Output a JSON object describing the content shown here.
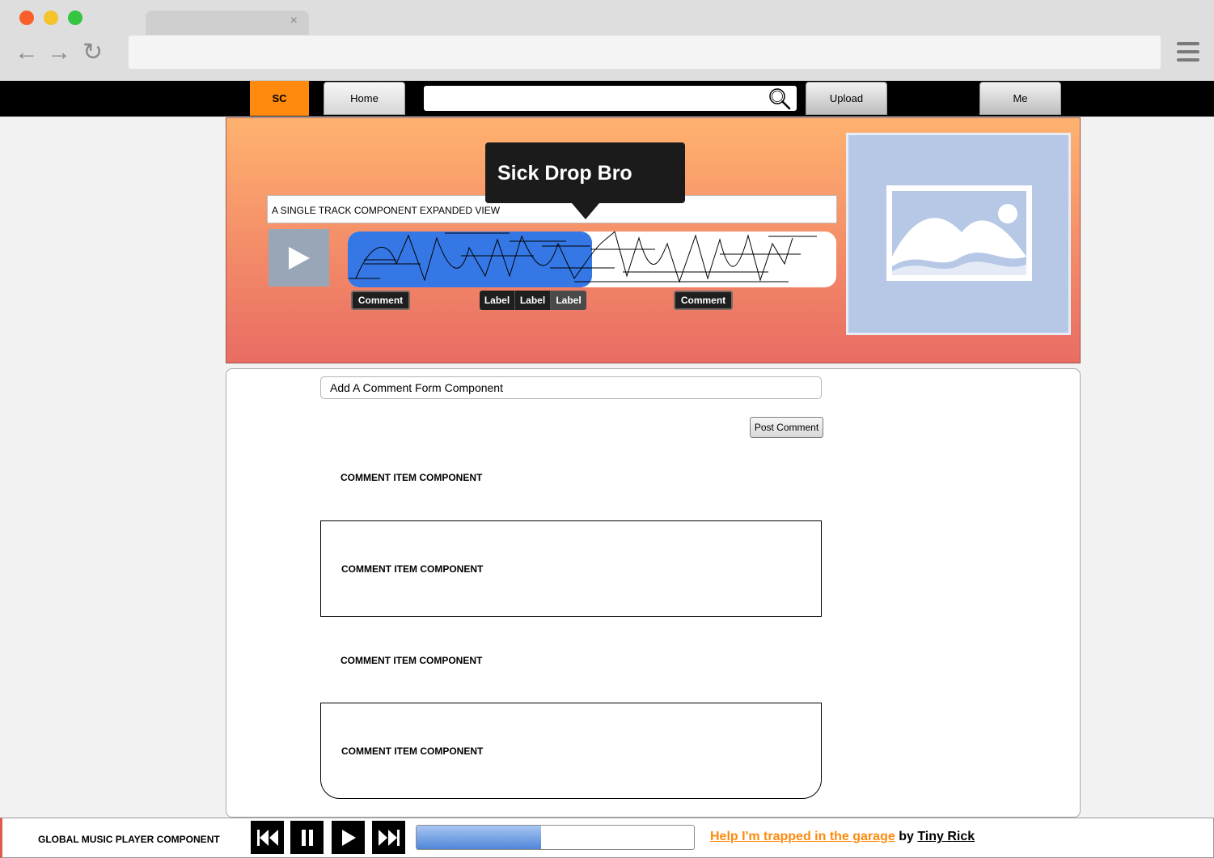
{
  "browser": {
    "tab_close": "×",
    "icons": [
      "back-arrow-icon",
      "forward-arrow-icon",
      "reload-icon",
      "hamburger-menu-icon"
    ]
  },
  "header": {
    "logo": "SC",
    "home_label": "Home",
    "search_placeholder": "",
    "upload_label": "Upload",
    "me_label": "Me",
    "colors": {
      "logo_bg": "#ff8a0d",
      "bar_bg": "#000000"
    }
  },
  "track": {
    "tooltip": "Sick Drop Bro",
    "title_bar": "A SINGLE TRACK COMPONENT EXPANDED VIEW",
    "waveform_progress": 0.5,
    "comment_chip_1": "Comment",
    "comment_chip_2": "Comment",
    "labels": [
      "Label",
      "Label",
      "Label"
    ],
    "colors": {
      "gradient_top": "#ffb26f",
      "gradient_bottom": "#e96c63",
      "progress": "#3578e5"
    }
  },
  "comments": {
    "input_value": "Add A Comment Form Component",
    "post_label": "Post Comment",
    "items": [
      "COMMENT ITEM COMPONENT",
      "COMMENT ITEM COMPONENT",
      "COMMENT ITEM COMPONENT",
      "COMMENT ITEM COMPONENT"
    ]
  },
  "player": {
    "label": "GLOBAL MUSIC PLAYER COMPONENT",
    "progress": 0.45,
    "track_title": "Help I'm trapped in the garage",
    "by": "by",
    "artist": "Tiny Rick",
    "colors": {
      "track_link": "#ff8a0d"
    }
  }
}
